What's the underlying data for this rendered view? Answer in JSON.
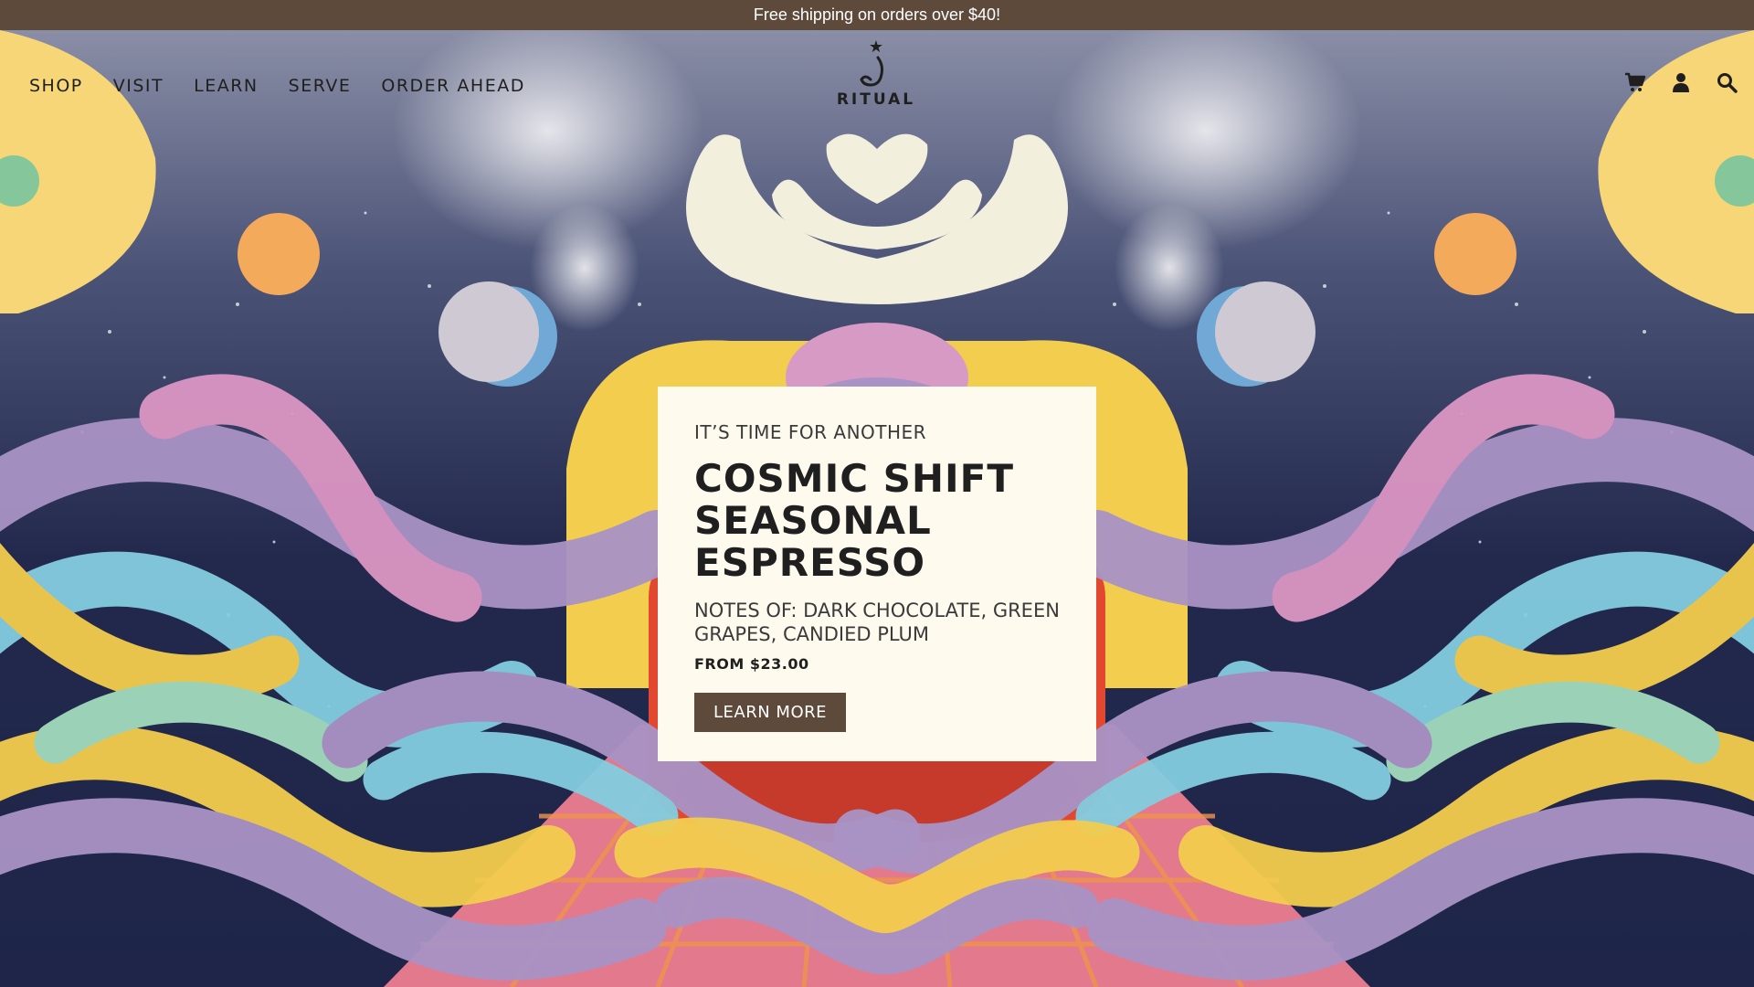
{
  "announcement": {
    "text": "Free shipping on orders over $40!"
  },
  "nav": {
    "items": [
      {
        "label": "SHOP"
      },
      {
        "label": "VISIT"
      },
      {
        "label": "LEARN"
      },
      {
        "label": "SERVE"
      },
      {
        "label": "ORDER AHEAD"
      }
    ]
  },
  "logo": {
    "text": "RITUAL",
    "icon": "ritual-logo-icon"
  },
  "header_icons": [
    "cart-icon",
    "account-icon",
    "search-icon"
  ],
  "hero": {
    "eyebrow": "IT’S TIME FOR ANOTHER",
    "title": "COSMIC SHIFT SEASONAL ESPRESSO",
    "notes": "NOTES OF: DARK CHOCOLATE, GREEN GRAPES, CANDIED PLUM",
    "price": "FROM $23.00",
    "cta": "LEARN MORE"
  },
  "colors": {
    "announcement_bg": "#5e4a3b",
    "card_bg": "#fffaee",
    "button_bg": "#5e4a3b",
    "sky": "#2a3358"
  }
}
